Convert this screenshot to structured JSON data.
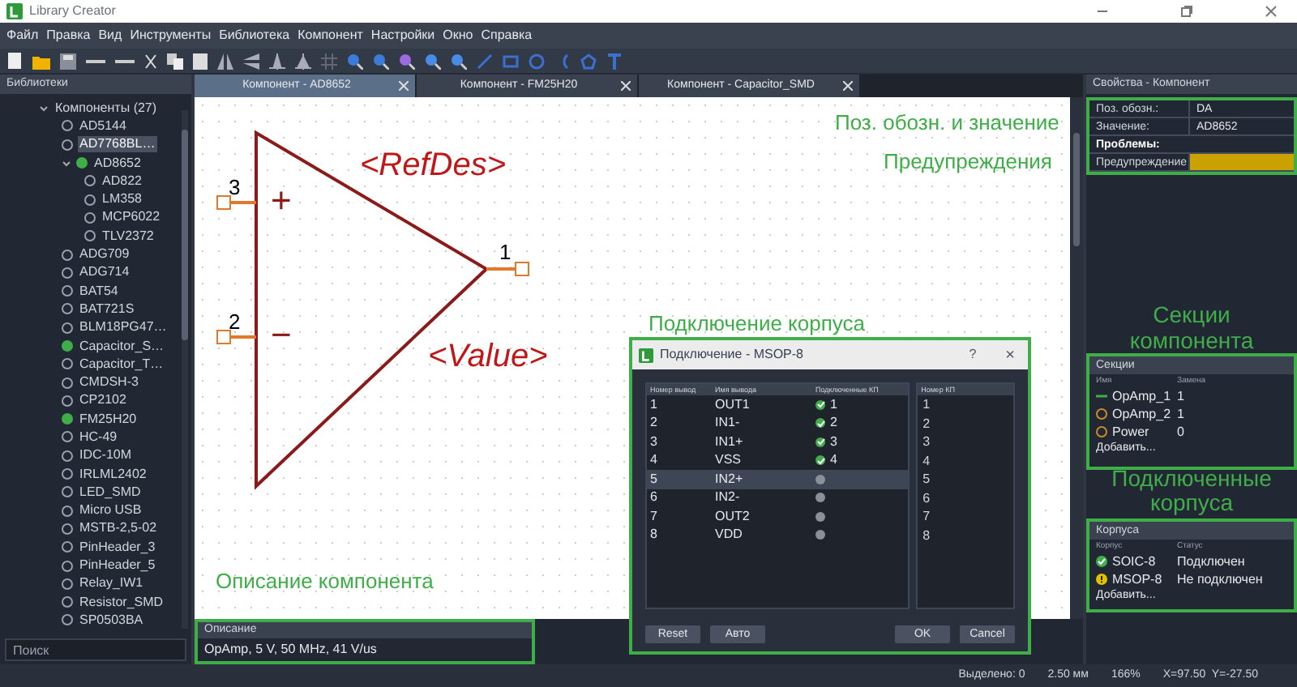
{
  "window": {
    "title": "Library Creator"
  },
  "menu": [
    "Файл",
    "Правка",
    "Вид",
    "Инструменты",
    "Библиотека",
    "Компонент",
    "Настройки",
    "Окно",
    "Справка"
  ],
  "libraries": {
    "title": "Библиотеки",
    "tree": [
      {
        "label": "Компоненты (27)",
        "expanded": true,
        "selected": false,
        "children": [
          {
            "label": "AD5144",
            "selected": false,
            "open": false
          },
          {
            "label": "AD7768BL…",
            "selected": true,
            "open": false
          },
          {
            "label": "AD8652",
            "selected": false,
            "open": true,
            "expanded": true,
            "children": [
              {
                "label": "AD822",
                "selected": false,
                "open": false
              },
              {
                "label": "LM358",
                "selected": false,
                "open": false
              },
              {
                "label": "MCP6022",
                "selected": false,
                "open": false
              },
              {
                "label": "TLV2372",
                "selected": false,
                "open": false
              }
            ]
          },
          {
            "label": "ADG709",
            "selected": false,
            "open": false
          },
          {
            "label": "ADG714",
            "selected": false,
            "open": false
          },
          {
            "label": "BAT54",
            "selected": false,
            "open": false
          },
          {
            "label": "BAT721S",
            "selected": false,
            "open": false
          },
          {
            "label": "BLM18PG47…",
            "selected": false,
            "open": false
          },
          {
            "label": "Capacitor_S…",
            "selected": false,
            "open": true
          },
          {
            "label": "Capacitor_T…",
            "selected": false,
            "open": false
          },
          {
            "label": "CMDSH-3",
            "selected": false,
            "open": false
          },
          {
            "label": "CP2102",
            "selected": false,
            "open": false
          },
          {
            "label": "FM25H20",
            "selected": false,
            "open": true
          },
          {
            "label": "HC-49",
            "selected": false,
            "open": false
          },
          {
            "label": "IDC-10M",
            "selected": false,
            "open": false
          },
          {
            "label": "IRLML2402",
            "selected": false,
            "open": false
          },
          {
            "label": "LED_SMD",
            "selected": false,
            "open": false
          },
          {
            "label": "Micro USB",
            "selected": false,
            "open": false
          },
          {
            "label": "MSTB-2,5-02",
            "selected": false,
            "open": false
          },
          {
            "label": "PinHeader_3",
            "selected": false,
            "open": false
          },
          {
            "label": "PinHeader_5",
            "selected": false,
            "open": false
          },
          {
            "label": "Relay_IW1",
            "selected": false,
            "open": false
          },
          {
            "label": "Resistor_SMD",
            "selected": false,
            "open": false
          },
          {
            "label": "SP0503BA",
            "selected": false,
            "open": false
          }
        ]
      }
    ],
    "search": {
      "placeholder": "Поиск"
    }
  },
  "tabs": [
    {
      "label": "Компонент - AD8652",
      "selected": true
    },
    {
      "label": "Компонент - FM25H20",
      "selected": false
    },
    {
      "label": "Компонент - Capacitor_SMD",
      "selected": false
    }
  ],
  "symbol": {
    "refdes": "<RefDes>",
    "value": "<Value>",
    "inputs": [
      {
        "pin": "3",
        "sign": "+"
      },
      {
        "pin": "2",
        "sign": "−"
      }
    ],
    "output": {
      "pin": "1"
    }
  },
  "description": {
    "title": "Описание",
    "text": "OpAmp, 5 V, 50 MHz, 41 V/us"
  },
  "annotations": [
    "Поз. обозн. и значение",
    "Предупреждения",
    "Подключение корпуса",
    "Описание компонента",
    "Секции компонента",
    "Подключенные корпуса"
  ],
  "dialog": {
    "title": "Подключение - MSOP-8",
    "help": "?",
    "close": "×",
    "columns": [
      "Номер вывод",
      "Имя вывода",
      "Подключенные КП"
    ],
    "rows": [
      {
        "number": "1",
        "name": "OUT1",
        "connected": true,
        "pad": "1",
        "selected": false
      },
      {
        "number": "2",
        "name": "IN1-",
        "connected": true,
        "pad": "2",
        "selected": false
      },
      {
        "number": "3",
        "name": "IN1+",
        "connected": true,
        "pad": "3",
        "selected": false
      },
      {
        "number": "4",
        "name": "VSS",
        "connected": true,
        "pad": "4",
        "selected": false
      },
      {
        "number": "5",
        "name": "IN2+",
        "connected": false,
        "selected": true
      },
      {
        "number": "6",
        "name": "IN2-",
        "connected": false,
        "selected": false
      },
      {
        "number": "7",
        "name": "OUT2",
        "connected": false,
        "selected": false
      },
      {
        "number": "8",
        "name": "VDD",
        "connected": false,
        "selected": false
      }
    ],
    "pads_column": "Номер КП",
    "pads": [
      "1",
      "2",
      "3",
      "4",
      "5",
      "6",
      "7",
      "8"
    ],
    "buttons": [
      "Reset",
      "Авто",
      "OK",
      "Cancel"
    ]
  },
  "properties": {
    "title": "Свойства - Компонент",
    "rows": [
      {
        "kind": "field",
        "label": "Поз. обозн.:",
        "value": "DA"
      },
      {
        "kind": "field",
        "label": "Значение:",
        "value": "AD8652"
      },
      {
        "kind": "heading",
        "label": "Проблемы:"
      },
      {
        "kind": "warning",
        "label": "Предупреждение"
      }
    ]
  },
  "sections": {
    "title": "Секции",
    "columns": [
      "Имя",
      "Замена"
    ],
    "rows": [
      {
        "name": "OpAmp_1",
        "swap": "1",
        "selected": true
      },
      {
        "name": "OpAmp_2",
        "swap": "1",
        "selected": false
      },
      {
        "name": "Power",
        "swap": "0",
        "selected": false
      }
    ],
    "add": "Добавить..."
  },
  "packages": {
    "title": "Корпуса",
    "columns": [
      "Корпус",
      "Статус"
    ],
    "rows": [
      {
        "name": "SOIC-8",
        "status": "Подключен",
        "connected": true
      },
      {
        "name": "MSOP-8",
        "status": "Не подключен",
        "connected": false
      }
    ],
    "add": "Добавить..."
  },
  "status_bar": [
    "Выделено: 0",
    "2.50 мм",
    "166%",
    "X=97.50  Y=-27.50"
  ]
}
